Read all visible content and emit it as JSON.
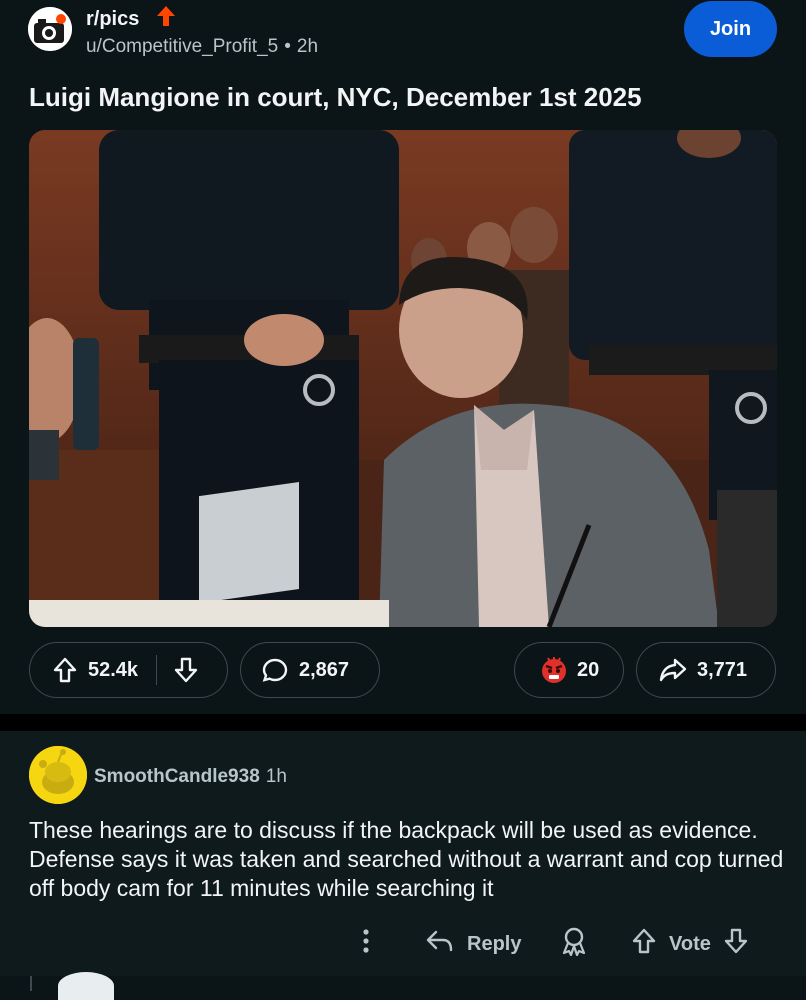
{
  "post": {
    "subreddit": "r/pics",
    "author": "u/Competitive_Profit_5",
    "time": "2h",
    "join_label": "Join",
    "title": "Luigi Mangione in court, NYC, December 1st 2025",
    "actions": {
      "upvotes": "52.4k",
      "comments": "2,867",
      "awards": "20",
      "shares": "3,771"
    }
  },
  "comment": {
    "username": "SmoothCandle938",
    "time": "1h",
    "body": "These hearings are to discuss if the backpack will be used as evidence. Defense says it was taken and searched without a warrant and cop turned off body cam for 11 minutes while searching it",
    "reply_label": "Reply",
    "vote_label": "Vote"
  },
  "icons": {
    "trend": "arrow-up-icon",
    "upvote": "upvote-icon",
    "downvote": "downvote-icon",
    "comment": "comment-icon",
    "award": "angry-face-award-icon",
    "share": "share-icon",
    "more": "more-vertical-icon",
    "reply": "reply-icon",
    "give_award": "award-icon"
  },
  "colors": {
    "background": "#0b1416",
    "join_button": "#0a5dd6",
    "trend_arrow": "#ff4500",
    "comment_avatar": "#f5d611"
  }
}
